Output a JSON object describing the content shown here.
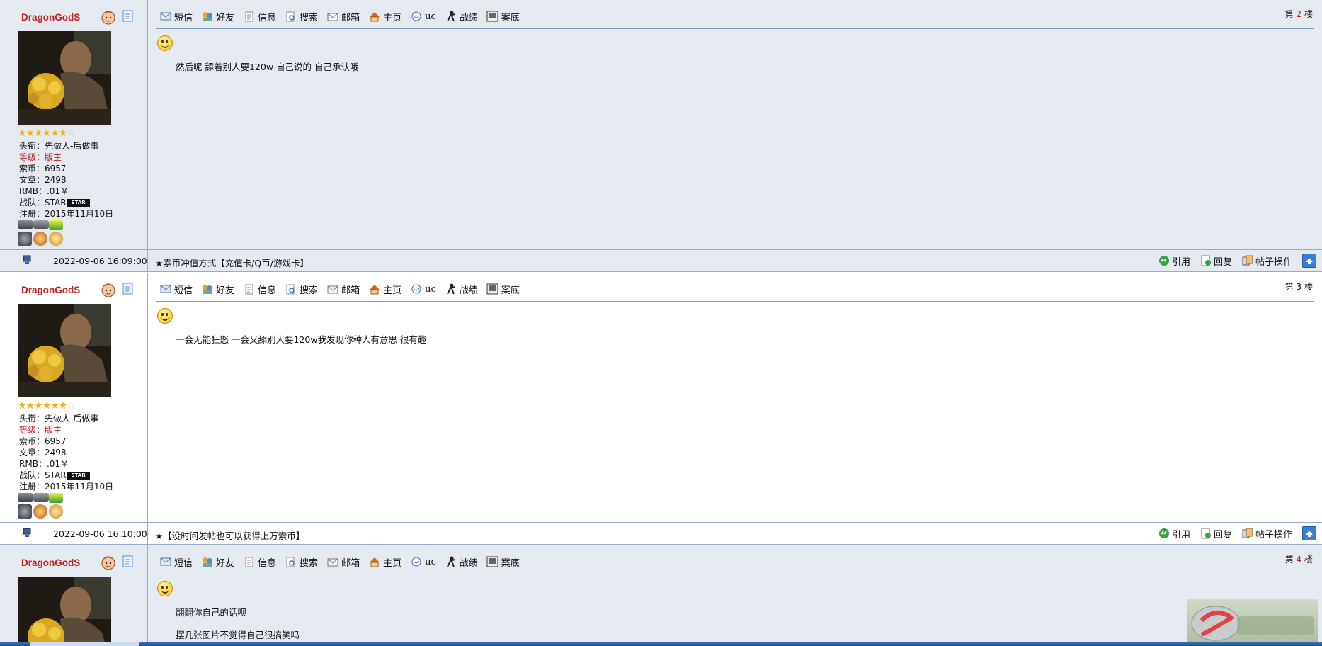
{
  "common_user": {
    "username": "DragonGodS",
    "stars_filled": 6,
    "stars_total": 7,
    "title_label": "头衔：",
    "title_value": "先做人-后做事",
    "rank_label": "等级：",
    "rank_value": "版主",
    "coins_label": "索币：",
    "coins_value": "6957",
    "posts_label": "文章：",
    "posts_value": "2498",
    "rmb_label": "RMB：",
    "rmb_value": ".01￥",
    "team_label": "战队：",
    "team_value": "STAR",
    "team_badge": "STAR",
    "reg_label": "注册：",
    "reg_value": "2015年11月10日"
  },
  "toolbar": {
    "sms": "短信",
    "friend": "好友",
    "info": "信息",
    "search": "搜索",
    "mail": "邮箱",
    "home": "主页",
    "uc": "uc",
    "record": "战绩",
    "case": "案底"
  },
  "floor": {
    "prefix": "第",
    "suffix": "楼"
  },
  "footer_actions": {
    "quote": "引用",
    "reply": "回复",
    "manage": "帖子操作"
  },
  "posts": [
    {
      "floor": "2",
      "lines": [
        "然后呢 舔着别人要120w 自己说的 自己承认哦"
      ],
      "date": "2022-09-06 16:09:00",
      "notice": "★索币冲值方式【充值卡/Q币/游戏卡】"
    },
    {
      "floor": "3",
      "lines": [
        "一会无能狂怒 一会又舔别人要120w我发现你种人有意思 很有趣"
      ],
      "date": "2022-09-06 16:10:00",
      "notice": "★【没时间发帖也可以获得上万索币】"
    },
    {
      "floor": "4",
      "lines": [
        "翻翻你自己的话呗",
        "摆几张图片不觉得自己很搞笑吗"
      ]
    }
  ],
  "colors": {
    "username": "#c02020",
    "panel_bg": "#e5eaf1",
    "border": "#98aac4",
    "divider": "#7b98bf"
  }
}
